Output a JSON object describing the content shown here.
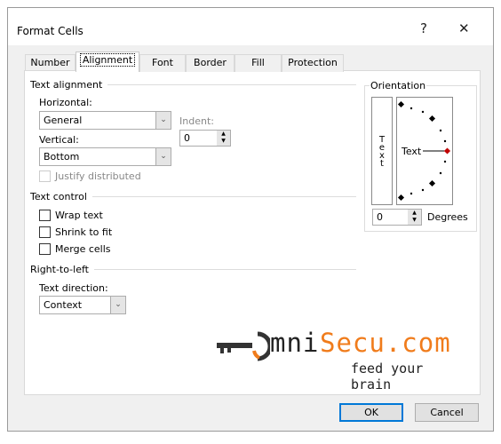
{
  "dialog": {
    "title": "Format Cells",
    "help": "?",
    "close": "✕"
  },
  "tabs": [
    "Number",
    "Alignment",
    "Font",
    "Border",
    "Fill",
    "Protection"
  ],
  "text_alignment": {
    "heading": "Text alignment",
    "horizontal_label": "Horizontal:",
    "horizontal_value": "General",
    "vertical_label": "Vertical:",
    "vertical_value": "Bottom",
    "indent_label": "Indent:",
    "indent_value": "0",
    "justify_distributed": "Justify distributed"
  },
  "text_control": {
    "heading": "Text control",
    "wrap": "Wrap text",
    "shrink": "Shrink to fit",
    "merge": "Merge cells"
  },
  "rtl": {
    "heading": "Right-to-left",
    "direction_label": "Text direction:",
    "direction_value": "Context"
  },
  "orientation": {
    "heading": "Orientation",
    "vertical_text": "Text",
    "dial_text": "Text",
    "degrees_value": "0",
    "degrees_label": "Degrees"
  },
  "logo": {
    "brand_dark": "mni",
    "brand_orange": "Secu.com",
    "tagline": "feed your brain"
  },
  "buttons": {
    "ok": "OK",
    "cancel": "Cancel"
  },
  "colors": {
    "accent": "#0078d7",
    "logo_orange": "#f07c1c",
    "dial_marker": "#c00000"
  }
}
